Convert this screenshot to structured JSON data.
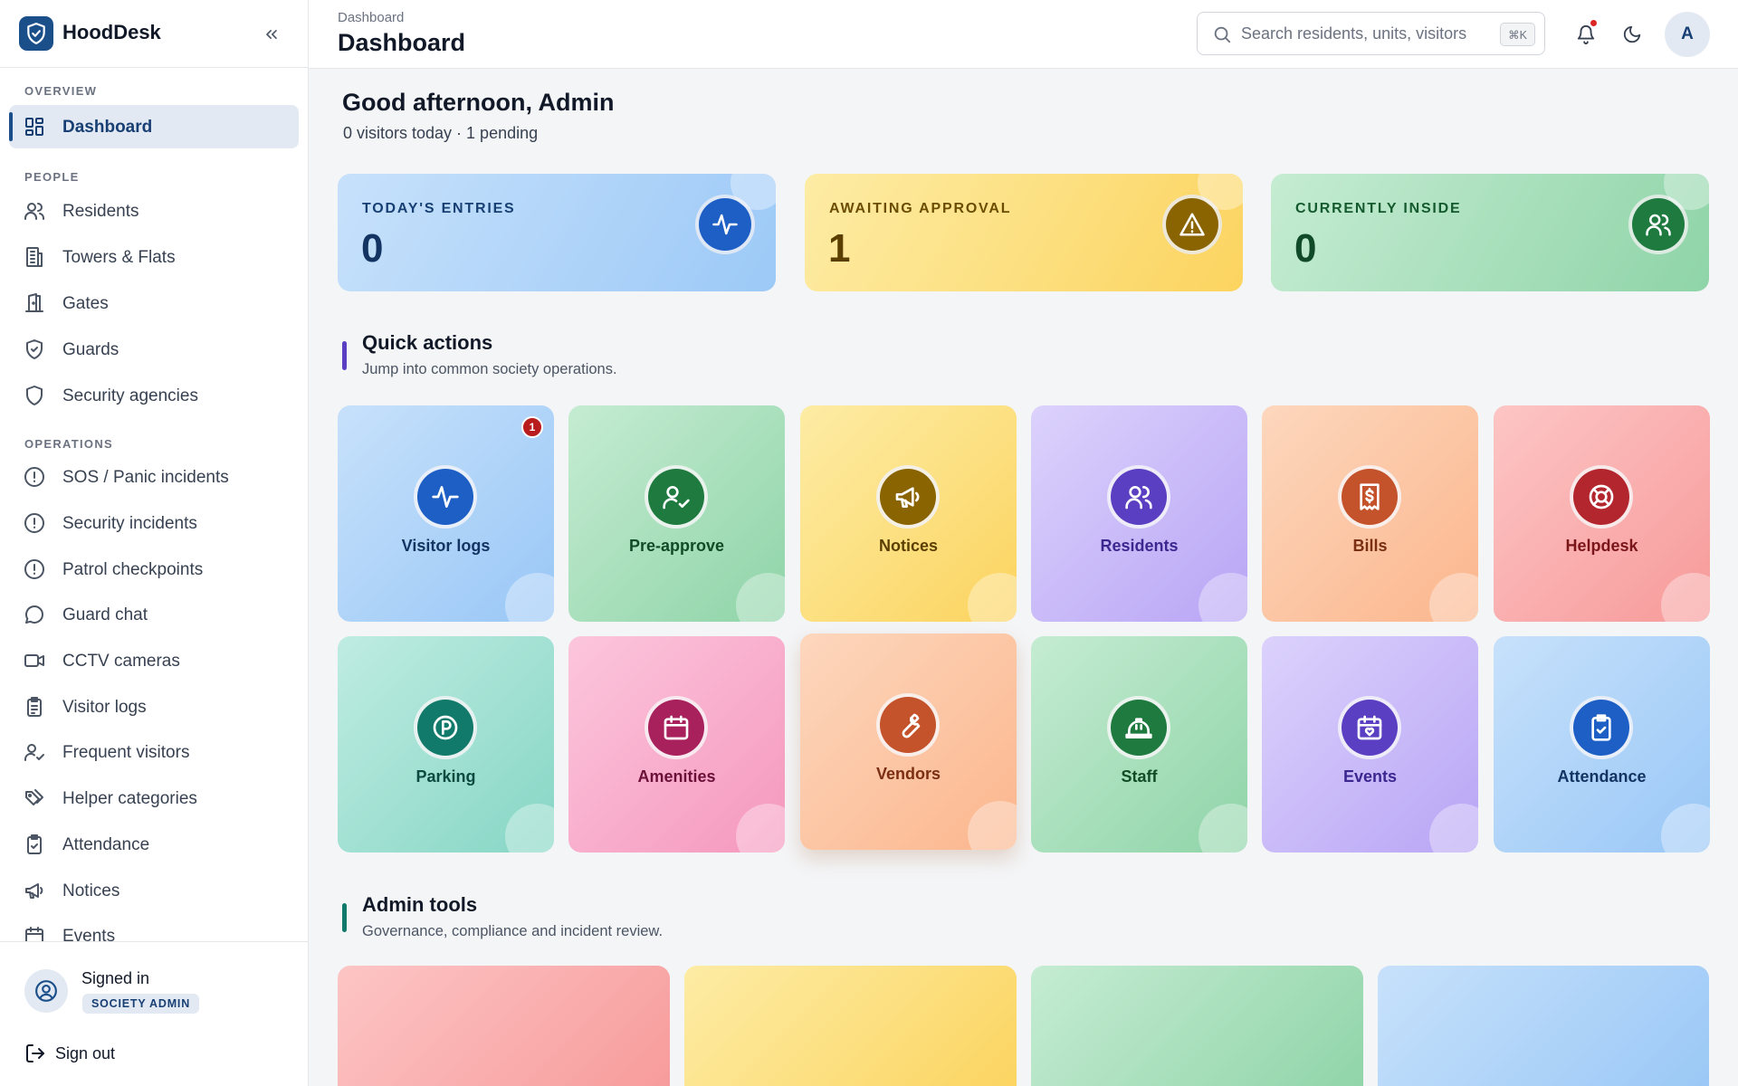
{
  "app": {
    "name": "HoodDesk"
  },
  "sidebar": {
    "sections": [
      {
        "title": "Overview",
        "items": [
          {
            "label": "Dashboard",
            "icon": "dashboard-icon",
            "active": true
          }
        ]
      },
      {
        "title": "People",
        "items": [
          {
            "label": "Residents",
            "icon": "users-icon"
          },
          {
            "label": "Towers & Flats",
            "icon": "building-icon"
          },
          {
            "label": "Gates",
            "icon": "gate-icon"
          },
          {
            "label": "Guards",
            "icon": "shield-check-icon"
          },
          {
            "label": "Security agencies",
            "icon": "shield-icon"
          }
        ]
      },
      {
        "title": "Operations",
        "items": [
          {
            "label": "SOS / Panic incidents",
            "icon": "alert-circle-icon"
          },
          {
            "label": "Security incidents",
            "icon": "alert-circle-icon"
          },
          {
            "label": "Patrol checkpoints",
            "icon": "alert-circle-icon"
          },
          {
            "label": "Guard chat",
            "icon": "chat-icon"
          },
          {
            "label": "CCTV cameras",
            "icon": "video-icon"
          },
          {
            "label": "Visitor logs",
            "icon": "clipboard-list-icon"
          },
          {
            "label": "Frequent visitors",
            "icon": "user-check-icon"
          },
          {
            "label": "Helper categories",
            "icon": "tags-icon"
          },
          {
            "label": "Attendance",
            "icon": "clipboard-check-icon"
          },
          {
            "label": "Notices",
            "icon": "megaphone-icon"
          },
          {
            "label": "Events",
            "icon": "calendar-icon"
          }
        ]
      }
    ],
    "footer": {
      "signed_in_label": "Signed in",
      "role": "SOCIETY ADMIN",
      "sign_out": "Sign out"
    }
  },
  "topbar": {
    "breadcrumb": "Dashboard",
    "title": "Dashboard",
    "search_placeholder": "Search residents, units, visitors",
    "search_shortcut": "⌘K",
    "avatar_initial": "A"
  },
  "greeting": {
    "title": "Good afternoon, Admin",
    "subtitle": "0 visitors today · 1 pending"
  },
  "stats": [
    {
      "label": "Today's entries",
      "value": "0",
      "icon": "activity-icon"
    },
    {
      "label": "Awaiting approval",
      "value": "1",
      "icon": "warning-icon"
    },
    {
      "label": "Currently inside",
      "value": "0",
      "icon": "users-icon"
    }
  ],
  "quick_actions": {
    "title": "Quick actions",
    "subtitle": "Jump into common society operations.",
    "items": [
      {
        "label": "Visitor logs",
        "icon": "activity-icon",
        "badge": "1"
      },
      {
        "label": "Pre-approve",
        "icon": "user-check-icon"
      },
      {
        "label": "Notices",
        "icon": "megaphone-icon"
      },
      {
        "label": "Residents",
        "icon": "users-icon"
      },
      {
        "label": "Bills",
        "icon": "receipt-icon"
      },
      {
        "label": "Helpdesk",
        "icon": "lifebuoy-icon"
      },
      {
        "label": "Parking",
        "icon": "parking-icon"
      },
      {
        "label": "Amenities",
        "icon": "calendar-icon"
      },
      {
        "label": "Vendors",
        "icon": "wrench-icon"
      },
      {
        "label": "Staff",
        "icon": "hardhat-icon"
      },
      {
        "label": "Events",
        "icon": "calendar-heart-icon"
      },
      {
        "label": "Attendance",
        "icon": "clipboard-check-icon"
      }
    ]
  },
  "admin_tools": {
    "title": "Admin tools",
    "subtitle": "Governance, compliance and incident review."
  },
  "colors": {
    "brand": "#1b4f8a",
    "blue": "#1d5fc4",
    "amber": "#8a6400",
    "green": "#1e7a3f",
    "purple": "#5b3fc2",
    "orange": "#c4522b",
    "red": "#b3262e",
    "teal": "#127a6a",
    "pink": "#a8205c"
  }
}
